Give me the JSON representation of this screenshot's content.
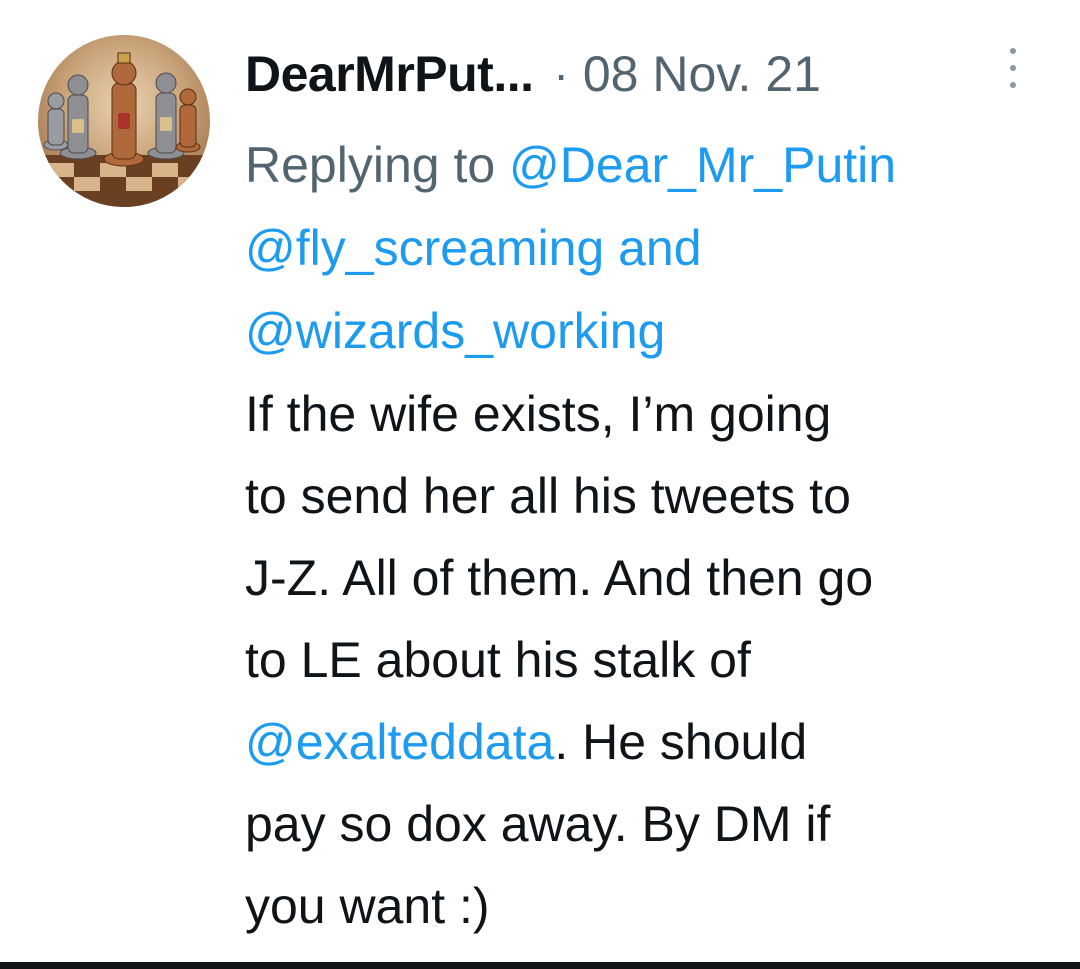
{
  "tweet": {
    "display_name": "DearMrPut...",
    "separator": "·",
    "date": "08 Nov. 21",
    "avatar_icon": "chess-pieces-avatar-icon",
    "more_icon": "vertical-dots-icon",
    "reply": {
      "prefix": "Replying to ",
      "mention_1": "@Dear_Mr_Putin",
      "mention_2": "@fly_screaming",
      "conjunction": " and",
      "mention_3": "@wizards_working"
    },
    "body": {
      "line_1": "If the wife exists, I’m going",
      "line_2": "to send her all his tweets to",
      "line_3": "J-Z. All of them. And then go",
      "line_4": "to LE about his stalk of",
      "line_5_mention": "@exalteddata",
      "line_5_rest": ". He should",
      "line_6": "pay so dox away. By DM if",
      "line_7": "you want :)"
    }
  },
  "colors": {
    "text": "#0f1419",
    "secondary": "#536471",
    "link": "#1d9bf0"
  }
}
